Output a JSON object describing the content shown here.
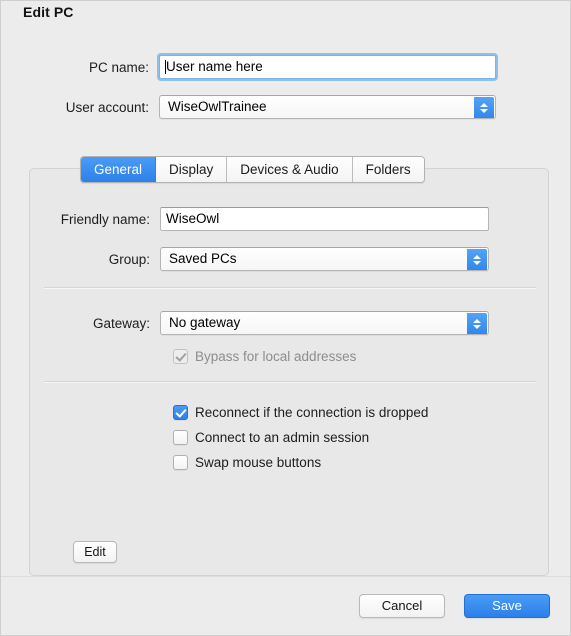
{
  "window": {
    "title": "Edit PC"
  },
  "form": {
    "pc_name": {
      "label": "PC name:",
      "value": "User name here",
      "placeholder": "PC name",
      "focused": true
    },
    "user_account": {
      "label": "User account:",
      "value": "WiseOwlTrainee"
    }
  },
  "tabs": [
    {
      "label": "General",
      "active": true
    },
    {
      "label": "Display",
      "active": false
    },
    {
      "label": "Devices & Audio",
      "active": false
    },
    {
      "label": "Folders",
      "active": false
    }
  ],
  "general": {
    "friendly_name": {
      "label": "Friendly name:",
      "value": "WiseOwl",
      "placeholder": "Friendly name"
    },
    "group": {
      "label": "Group:",
      "value": "Saved PCs"
    },
    "gateway": {
      "label": "Gateway:",
      "value": "No gateway"
    },
    "bypass": {
      "label": "Bypass for local addresses",
      "checked": true,
      "enabled": false
    },
    "options": [
      {
        "label": "Reconnect if the connection is dropped",
        "checked": true
      },
      {
        "label": "Connect to an admin session",
        "checked": false
      },
      {
        "label": "Swap mouse buttons",
        "checked": false
      }
    ],
    "edit_button": "Edit"
  },
  "footer": {
    "cancel": "Cancel",
    "save": "Save"
  },
  "colors": {
    "accent": "#2b7fe9",
    "window_bg": "#ececec",
    "panel_bg": "#e8e8e8",
    "text": "#1d1d1d",
    "disabled_text": "#8d8d8d"
  }
}
